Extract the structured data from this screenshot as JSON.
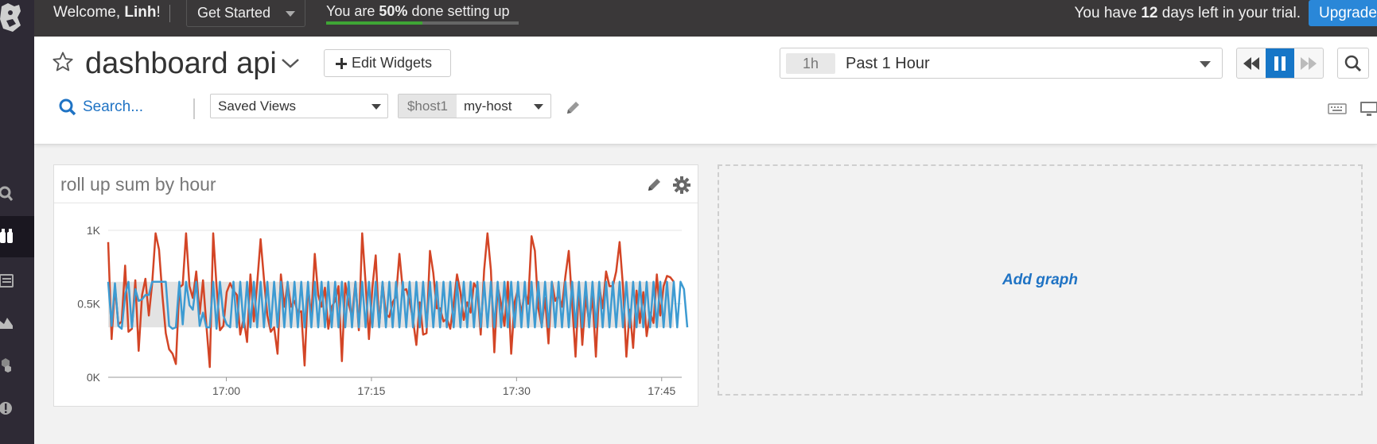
{
  "topbar": {
    "welcome_prefix": "Welcome, ",
    "user_name": "Linh",
    "welcome_suffix": "!",
    "get_started": "Get Started",
    "setup_prefix": "You are ",
    "setup_percent": "50%",
    "setup_suffix": " done setting up",
    "setup_progress": 0.5,
    "trial_prefix": "You have ",
    "trial_days": "12",
    "trial_suffix": " days left in your trial.",
    "upgrade": "Upgrade"
  },
  "header": {
    "title": "dashboard api",
    "edit_widgets": "Edit Widgets",
    "time_chip": "1h",
    "time_label": "Past 1 Hour",
    "search": "Search...",
    "saved_views": "Saved Views",
    "host_var_name": "$host1",
    "host_var_value": "my-host"
  },
  "widget": {
    "title": "roll up sum by hour"
  },
  "add_graph": "Add graph",
  "colors": {
    "series_red": "#d34526",
    "series_blue": "#3d9bd2",
    "band": "#e3e3e3",
    "accent": "#1f73c4"
  },
  "chart_data": {
    "type": "line",
    "y_tick_labels": [
      "0K",
      "0.5K",
      "1K"
    ],
    "ylim": [
      0,
      1000
    ],
    "x_tick_labels": [
      "17:00",
      "17:15",
      "17:30",
      "17:45"
    ],
    "x_range_minutes": [
      47.7,
      48.4
    ],
    "band": {
      "lower": 340,
      "upper": 650
    },
    "series": [
      {
        "color": "#d34526",
        "values": [
          920,
          260,
          620,
          360,
          380,
          760,
          310,
          330,
          660,
          180,
          560,
          670,
          420,
          640,
          980,
          870,
          560,
          300,
          190,
          160,
          90,
          610,
          630,
          980,
          620,
          540,
          720,
          430,
          660,
          350,
          70,
          980,
          620,
          320,
          350,
          580,
          640,
          590,
          560,
          290,
          400,
          240,
          700,
          380,
          640,
          940,
          670,
          420,
          310,
          340,
          160,
          700,
          480,
          640,
          480,
          520,
          440,
          450,
          80,
          620,
          410,
          840,
          560,
          480,
          610,
          330,
          480,
          520,
          620,
          110,
          640,
          500,
          410,
          650,
          320,
          980,
          640,
          260,
          610,
          830,
          350,
          640,
          430,
          410,
          510,
          550,
          840,
          590,
          600,
          520,
          390,
          220,
          510,
          290,
          300,
          860,
          710,
          470,
          470,
          380,
          400,
          330,
          500,
          700,
          580,
          390,
          510,
          440,
          640,
          600,
          290,
          730,
          980,
          730,
          170,
          620,
          500,
          350,
          650,
          160,
          510,
          600,
          430,
          590,
          500,
          960,
          860,
          470,
          350,
          540,
          230,
          650,
          520,
          560,
          480,
          690,
          860,
          500,
          140,
          620,
          220,
          550,
          370,
          550,
          140,
          620,
          470,
          720,
          620,
          620,
          720,
          920,
          620,
          140,
          460,
          200,
          590,
          370,
          580,
          280,
          440,
          370,
          700,
          420,
          620,
          690,
          680,
          650
        ]
      },
      {
        "color": "#3d9bd2",
        "values": [
          650,
          350,
          640,
          350,
          330,
          560,
          650,
          340,
          600,
          520,
          530,
          560,
          560,
          650,
          650,
          650,
          650,
          650,
          350,
          330,
          340,
          650,
          360,
          650,
          490,
          460,
          650,
          350,
          440,
          340,
          340,
          650,
          330,
          650,
          420,
          360,
          340,
          650,
          340,
          650,
          340,
          650,
          340,
          650,
          340,
          650,
          340,
          650,
          340,
          650,
          340,
          650,
          340,
          650,
          340,
          650,
          340,
          650,
          340,
          650,
          340,
          650,
          340,
          650,
          340,
          650,
          340,
          650,
          340,
          650,
          340,
          650,
          340,
          650,
          340,
          650,
          340,
          650,
          340,
          650,
          340,
          650,
          340,
          650,
          340,
          650,
          340,
          650,
          340,
          650,
          340,
          650,
          340,
          650,
          340,
          650,
          340,
          650,
          340,
          650,
          340,
          650,
          340,
          650,
          340,
          650,
          340,
          650,
          340,
          650,
          340,
          650,
          340,
          650,
          340,
          650,
          340,
          650,
          340,
          650,
          340,
          650,
          340,
          650,
          340,
          650,
          340,
          650,
          340,
          650,
          340,
          650,
          340,
          650,
          340,
          650,
          340,
          650,
          340,
          650,
          340,
          650,
          340,
          650,
          340,
          650,
          340,
          650,
          340,
          650,
          340,
          650,
          340,
          650,
          340,
          650,
          340,
          650,
          340,
          650,
          340,
          650,
          340,
          650,
          340,
          650,
          340,
          650,
          340,
          650,
          600,
          340
        ]
      }
    ]
  }
}
